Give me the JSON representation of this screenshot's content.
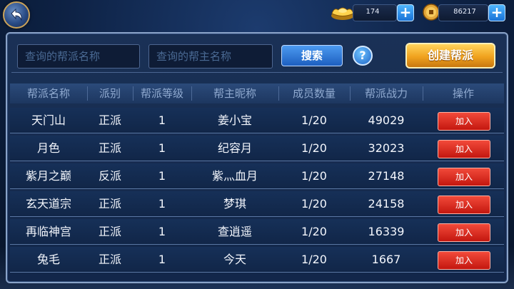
{
  "currency": {
    "ingot_value": "174",
    "coin_value": "86217"
  },
  "search": {
    "guild_name_placeholder": "查询的帮派名称",
    "leader_name_placeholder": "查询的帮主名称",
    "search_label": "搜索",
    "help_label": "?",
    "create_label": "创建帮派"
  },
  "table": {
    "headers": [
      "帮派名称",
      "派别",
      "帮派等级",
      "帮主昵称",
      "成员数量",
      "帮派战力",
      "操作"
    ],
    "rows": [
      {
        "name": "天门山",
        "faction": "正派",
        "level": "1",
        "leader": "姜小宝",
        "members": "1/20",
        "power": "49029",
        "action": "加入"
      },
      {
        "name": "月色",
        "faction": "正派",
        "level": "1",
        "leader": "纪容月",
        "members": "1/20",
        "power": "32023",
        "action": "加入"
      },
      {
        "name": "紫月之巅",
        "faction": "反派",
        "level": "1",
        "leader": "紫灬血月",
        "members": "1/20",
        "power": "27148",
        "action": "加入"
      },
      {
        "name": "玄天道宗",
        "faction": "正派",
        "level": "1",
        "leader": "梦琪",
        "members": "1/20",
        "power": "24158",
        "action": "加入"
      },
      {
        "name": "再临神宫",
        "faction": "正派",
        "level": "1",
        "leader": "查逍遥",
        "members": "1/20",
        "power": "16339",
        "action": "加入"
      },
      {
        "name": "兔毛",
        "faction": "正派",
        "level": "1",
        "leader": "今天",
        "members": "1/20",
        "power": "1667",
        "action": "加入"
      }
    ]
  },
  "icons": {
    "back": "back-arrow-icon",
    "ingot": "gold-ingot-icon",
    "coin": "copper-coin-icon",
    "plus": "plus-icon"
  },
  "colors": {
    "accent_gold": "#f0a21e",
    "accent_blue": "#1d5fc0",
    "join_red": "#c3170f"
  }
}
